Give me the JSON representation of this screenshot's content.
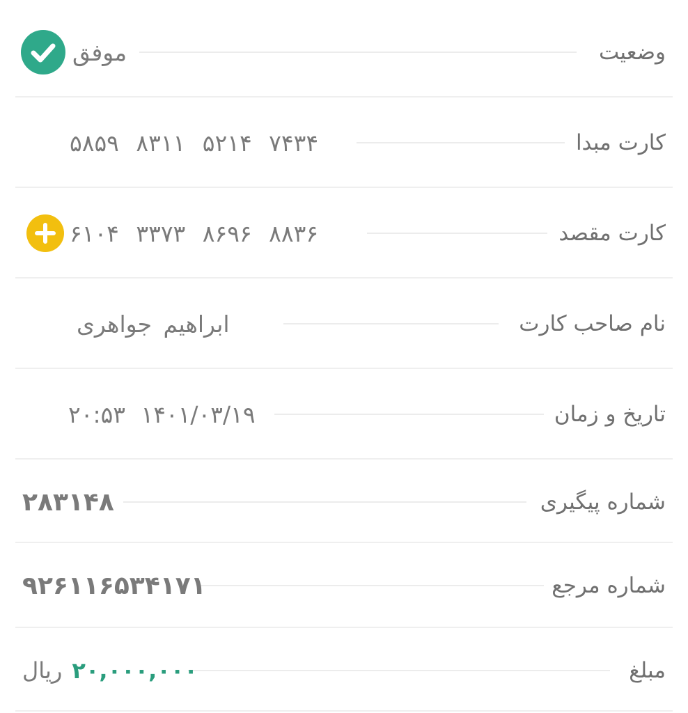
{
  "rows": {
    "status": {
      "label": "وضعیت",
      "value": "موفق"
    },
    "source_card": {
      "label": "کارت مبدا",
      "value": "۵۸۵۹  ۸۳۱۱  ۵۲۱۴  ۷۴۳۴"
    },
    "dest_card": {
      "label": "کارت مقصد",
      "value": "۶۱۰۴  ۳۳۷۳  ۸۶۹۶  ۸۸۳۶"
    },
    "card_holder": {
      "label": "نام صاحب کارت",
      "value": "ابراهیم   جواهری"
    },
    "datetime": {
      "label": "تاریخ و زمان",
      "value": "۱۴۰۱/۰۳/۱۹  ۲۰:۵۳"
    },
    "tracking": {
      "label": "شماره پیگیری",
      "value": "۲۸۳۱۴۸"
    },
    "reference": {
      "label": "شماره مرجع",
      "value": "۹۲۶۱۱۶۵۳۴۱۷۱"
    },
    "amount": {
      "label": "مبلغ",
      "value": "۲۰,۰۰۰,۰۰۰",
      "currency": "ریال"
    }
  },
  "colors": {
    "success": "#2fa98a",
    "add": "#f2bf0f",
    "amount": "#2a9d7d"
  },
  "icons": {
    "status": "check-circle-icon",
    "dest_card": "plus-circle-icon"
  }
}
